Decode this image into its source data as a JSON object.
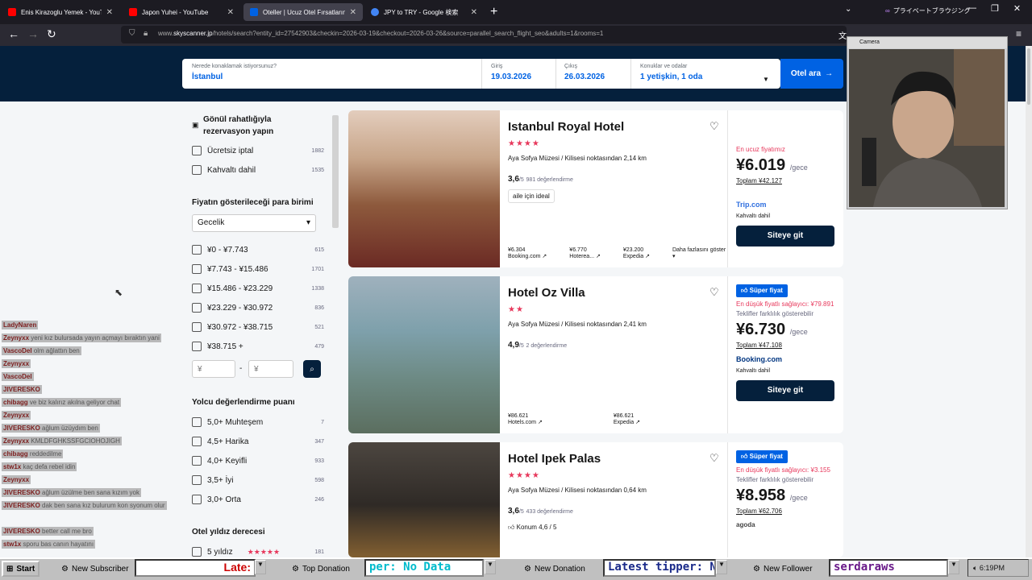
{
  "browser": {
    "tabs": [
      {
        "label": "Enis Kirazoglu Yemek - YouTube",
        "icon": "youtube-icon",
        "color": "#ff0000"
      },
      {
        "label": "Japon Yuhei - YouTube",
        "icon": "youtube-icon",
        "color": "#ff0000"
      },
      {
        "label": "Oteller | Ucuz Otel Fırsatlarını K",
        "icon": "skyscanner-icon",
        "color": "#0062e3"
      },
      {
        "label": "JPY to TRY - Google 検索",
        "icon": "google-icon",
        "color": "#4285f4"
      }
    ],
    "private_label": "プライベートブラウジング",
    "url_prefix": "www.",
    "url_domain": "skyscanner.jp",
    "url_rest": "/hotels/search?entity_id=27542903&checkin=2026-03-19&checkout=2026-03-26&source=parallel_search_flight_seo&adults=1&rooms=1"
  },
  "search": {
    "dest_label": "Nerede konaklamak istiyorsunuz?",
    "dest_value": "İstanbul",
    "checkin_label": "Giriş",
    "checkin_value": "19.03.2026",
    "checkout_label": "Çıkış",
    "checkout_value": "26.03.2026",
    "guests_label": "Konuklar ve odalar",
    "guests_value": "1 yetişkin, 1 oda",
    "button": "Otel ara"
  },
  "filters": {
    "book_title": "Gönül rahatlığıyla rezervasyon yapın",
    "book_items": [
      {
        "label": "Ücretsiz iptal",
        "count": "1882"
      },
      {
        "label": "Kahvaltı dahil",
        "count": "1535"
      }
    ],
    "currency_title": "Fiyatın gösterileceği para birimi",
    "currency_value": "Gecelik",
    "price_items": [
      {
        "label": "¥0 - ¥7.743",
        "count": "615"
      },
      {
        "label": "¥7.743 - ¥15.486",
        "count": "1701"
      },
      {
        "label": "¥15.486 - ¥23.229",
        "count": "1338"
      },
      {
        "label": "¥23.229 - ¥30.972",
        "count": "836"
      },
      {
        "label": "¥30.972 - ¥38.715",
        "count": "521"
      },
      {
        "label": "¥38.715 +",
        "count": "479"
      }
    ],
    "min_placeholder": "¥",
    "max_placeholder": "¥",
    "dash": "-",
    "rating_title": "Yolcu değerlendirme puanı",
    "rating_items": [
      {
        "label": "5,0+  Muhteşem",
        "count": "7"
      },
      {
        "label": "4,5+  Harika",
        "count": "347"
      },
      {
        "label": "4,0+  Keyifli",
        "count": "933"
      },
      {
        "label": "3,5+  İyi",
        "count": "598"
      },
      {
        "label": "3,0+  Orta",
        "count": "246"
      }
    ],
    "stars_title": "Otel yıldız derecesi",
    "stars_item": {
      "label": "5 yıldız",
      "stars": "★★★★★",
      "count": "181"
    }
  },
  "hotels": [
    {
      "name": "Istanbul Royal Hotel",
      "stars": "★★★★",
      "distance": "Aya Sofya Müzesi / Kilisesi noktasından 2,14 km",
      "score": "3,6",
      "score_suffix": "/5",
      "reviews": "981 değerlendirme",
      "tag": "aile için ideal",
      "prices": [
        {
          "p": "¥6.304",
          "s": "Booking.com"
        },
        {
          "p": "¥6.770",
          "s": "Hoterea..."
        },
        {
          "p": "¥23.200",
          "s": "Expedia"
        },
        {
          "p": "Daha fazlasını göster",
          "s": "▾"
        }
      ],
      "badge": "",
      "label1": "En ucuz fiyatımız",
      "label2": "",
      "price": "¥6.019",
      "per": "/gece",
      "total": "Toplam ¥42.127",
      "partner": "Trip.com",
      "partner_color": "#2f6fdf",
      "breakfast": "Kahvaltı dahil",
      "button": "Siteye git"
    },
    {
      "name": "Hotel Oz Villa",
      "stars": "★★",
      "distance": "Aya Sofya Müzesi / Kilisesi noktasından 2,41 km",
      "score": "4,9",
      "score_suffix": "/5",
      "reviews": "2 değerlendirme",
      "tag": "",
      "prices": [
        {
          "p": "¥86.621",
          "s": "Hotels.com"
        },
        {
          "p": "¥86.621",
          "s": "Expedia"
        }
      ],
      "badge": "Süper fiyat",
      "label1": "En düşük fiyatlı sağlayıcı: ¥79.891",
      "label2": "Teklifler farklılık gösterebilir",
      "price": "¥6.730",
      "per": "/gece",
      "total": "Toplam ¥47.108",
      "partner": "Booking.com",
      "partner_color": "#003580",
      "breakfast": "Kahvaltı dahil",
      "button": "Siteye git"
    },
    {
      "name": "Hotel Ipek Palas",
      "stars": "★★★★",
      "distance": "Aya Sofya Müzesi / Kilisesi noktasından 0,64 km",
      "score": "3,6",
      "score_suffix": "/5",
      "reviews": "433 değerlendirme",
      "tag": "Konum 4,6 / 5",
      "prices": [],
      "badge": "Süper fiyat",
      "label1": "En düşük fiyatlı sağlayıcı: ¥3.155",
      "label2": "Teklifler farklılık gösterebilir",
      "price": "¥8.958",
      "per": "/gece",
      "total": "Toplam ¥62.706",
      "partner": "agoda",
      "partner_color": "#444",
      "breakfast": "",
      "button": "Siteye git"
    }
  ],
  "chat": [
    {
      "user": "LadyNaren",
      "msg": ""
    },
    {
      "user": "Zeynyxx",
      "msg": "yeni kız bulursada yayın açmayı bıraktın yani"
    },
    {
      "user": "VascoDel",
      "msg": "olm ağlattın ben"
    },
    {
      "user": "Zeynyxx",
      "msg": ""
    },
    {
      "user": "VascoDel",
      "msg": ""
    },
    {
      "user": "JIVERESKO",
      "msg": ""
    },
    {
      "user": "chibagg",
      "msg": "ve biz kalırız akılna geliyor chat"
    },
    {
      "user": "Zeynyxx",
      "msg": ""
    },
    {
      "user": "JIVERESKO",
      "msg": "ağlum üzüydım ben"
    },
    {
      "user": "Zeynyxx",
      "msg": "KMLDFGHKSSFGCIOHOJIGH"
    },
    {
      "user": "chibagg",
      "msg": "reddedilme"
    },
    {
      "user": "stw1x",
      "msg": "kaç defa rebel idin"
    },
    {
      "user": "Zeynyxx",
      "msg": ""
    },
    {
      "user": "JIVERESKO",
      "msg": "ağlum üzülme ben sana kızım yok"
    },
    {
      "user": "JIVERESKO",
      "msg": "dak ben sana kız bulurum kon syonum olur"
    },
    {
      "user": "JIVERESKO",
      "msg": "better call me bro"
    },
    {
      "user": "stw1x",
      "msg": "sporu bas canın hayatını"
    }
  ],
  "camera": {
    "title": "Camera"
  },
  "taskbar": {
    "start": "Start",
    "new_subscriber": "New Subscriber",
    "late": "Late:",
    "top_donation": "Top Donation",
    "tipper_box": "per: No Data",
    "new_donation": "New Donation",
    "latest_tipper": "Latest tipper: N",
    "new_follower": "New Follower",
    "follower_name": "serdaraws",
    "clock": "6:19PM"
  }
}
